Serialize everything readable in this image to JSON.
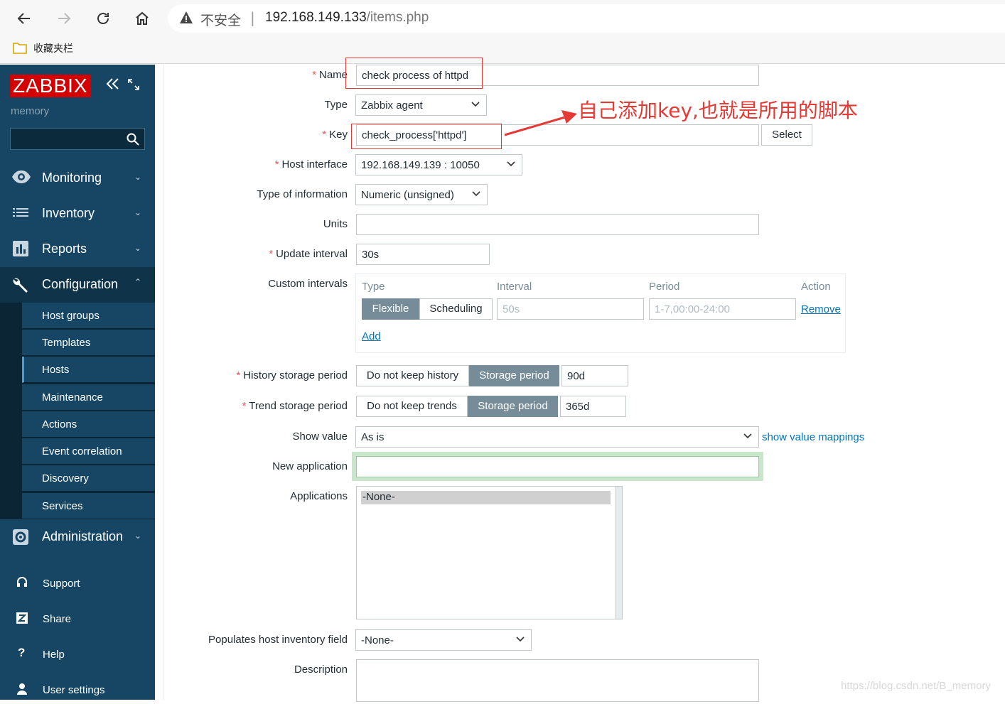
{
  "browser": {
    "insecure_label": "不安全",
    "separator": "|",
    "url_host": "192.168.149.133",
    "url_path": "/items.php",
    "favorites_label": "收藏夹栏"
  },
  "sidebar": {
    "logo": "ZABBIX",
    "server_name": "memory",
    "search_placeholder": "",
    "menu": [
      {
        "label": "Monitoring",
        "icon": "eye-icon"
      },
      {
        "label": "Inventory",
        "icon": "list-icon"
      },
      {
        "label": "Reports",
        "icon": "bar-chart-icon"
      },
      {
        "label": "Configuration",
        "icon": "wrench-icon"
      },
      {
        "label": "Administration",
        "icon": "gear-icon"
      }
    ],
    "config_submenu": [
      "Host groups",
      "Templates",
      "Hosts",
      "Maintenance",
      "Actions",
      "Event correlation",
      "Discovery",
      "Services"
    ],
    "selected_submenu": "Hosts",
    "bottom": [
      {
        "label": "Support",
        "icon": "headset-icon"
      },
      {
        "label": "Share",
        "icon": "share-z-icon"
      },
      {
        "label": "Help",
        "icon": "question-icon"
      },
      {
        "label": "User settings",
        "icon": "user-icon"
      }
    ]
  },
  "form": {
    "name": {
      "label": "Name",
      "value": "check process of httpd"
    },
    "type": {
      "label": "Type",
      "value": "Zabbix agent"
    },
    "key": {
      "label": "Key",
      "value": "check_process['httpd']",
      "select_button": "Select"
    },
    "host_interface": {
      "label": "Host interface",
      "value": "192.168.149.139 : 10050"
    },
    "type_of_information": {
      "label": "Type of information",
      "value": "Numeric (unsigned)"
    },
    "units": {
      "label": "Units",
      "value": ""
    },
    "update_interval": {
      "label": "Update interval",
      "value": "30s"
    },
    "custom_intervals": {
      "label": "Custom intervals",
      "columns": [
        "Type",
        "Interval",
        "Period",
        "Action"
      ],
      "row": {
        "type_on": "Flexible",
        "type_off": "Scheduling",
        "interval_placeholder": "50s",
        "period_placeholder": "1-7,00:00-24:00",
        "action": "Remove"
      },
      "add": "Add"
    },
    "history": {
      "label": "History storage period",
      "off": "Do not keep history",
      "on": "Storage period",
      "value": "90d"
    },
    "trend": {
      "label": "Trend storage period",
      "off": "Do not keep trends",
      "on": "Storage period",
      "value": "365d"
    },
    "show_value": {
      "label": "Show value",
      "value": "As is",
      "link": "show value mappings"
    },
    "new_application": {
      "label": "New application",
      "value": ""
    },
    "applications": {
      "label": "Applications",
      "options": [
        "-None-"
      ]
    },
    "inventory": {
      "label": "Populates host inventory field",
      "value": "-None-"
    },
    "description": {
      "label": "Description",
      "value": ""
    }
  },
  "annotation": {
    "text": "自己添加key,也就是所用的脚本",
    "color": "#e53935"
  },
  "watermark": "https://blog.csdn.net/B_memory",
  "colors": {
    "sidebar_bg": "#164663",
    "logo_bg": "#d40000",
    "segment_active": "#768d99",
    "link": "#0275b8",
    "required": "#e45959"
  }
}
